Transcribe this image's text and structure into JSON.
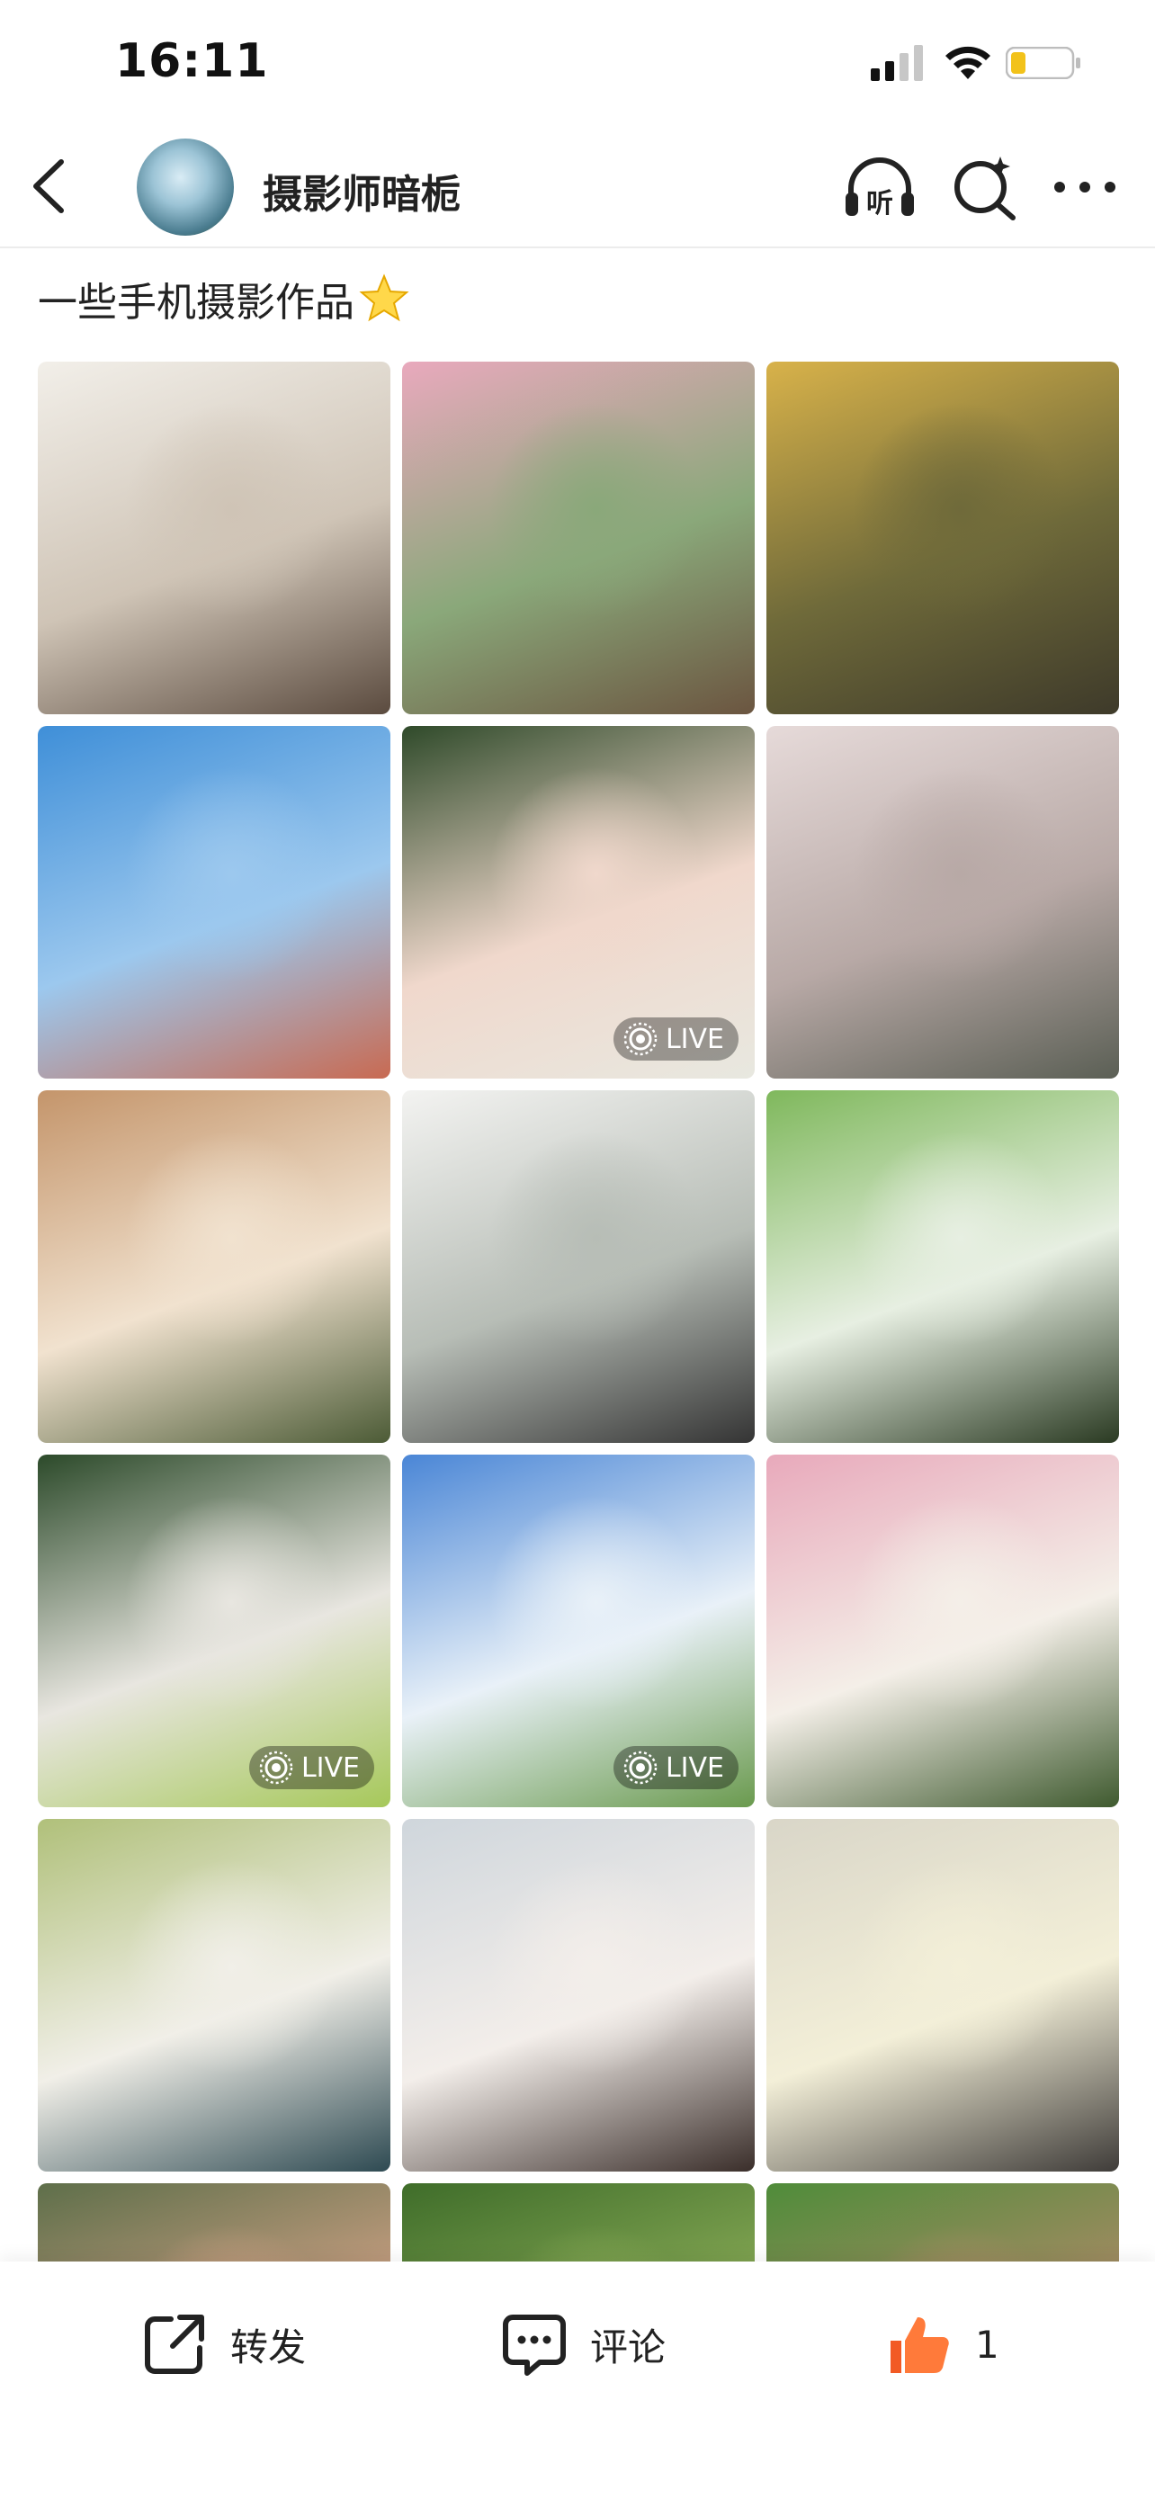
{
  "status_bar": {
    "time": "16:11",
    "icons": [
      "signal-icon",
      "wifi-icon",
      "battery-icon"
    ]
  },
  "nav": {
    "back_icon": "back-chevron-icon",
    "title": "摄影师暗栀",
    "listen_icon": "listen-headphones-icon",
    "listen_label": "听",
    "search_icon": "search-sparkle-icon",
    "more_icon": "more-dots-icon"
  },
  "post": {
    "text": "一些手机摄影作品",
    "emoji": "star-emoji"
  },
  "photos": [
    {
      "live": false,
      "colors": [
        "#f2efe9",
        "#cfc4b6",
        "#5b4b3f"
      ]
    },
    {
      "live": false,
      "colors": [
        "#e9a9bd",
        "#8aa87a",
        "#6b5540"
      ]
    },
    {
      "live": false,
      "colors": [
        "#d8b24a",
        "#6f6a3a",
        "#3e3a2a"
      ]
    },
    {
      "live": false,
      "colors": [
        "#3f8fd8",
        "#9cc8ee",
        "#c86a52"
      ]
    },
    {
      "live": true,
      "colors": [
        "#2f4a2a",
        "#f0d8cc",
        "#e8e8e0"
      ]
    },
    {
      "live": false,
      "colors": [
        "#e6dad9",
        "#b8a9a6",
        "#5b5f55"
      ]
    },
    {
      "live": false,
      "colors": [
        "#c4956b",
        "#f1e2cf",
        "#4c5b36"
      ]
    },
    {
      "live": false,
      "colors": [
        "#f3f3f1",
        "#b7bdb6",
        "#343434"
      ]
    },
    {
      "live": false,
      "colors": [
        "#7fb85c",
        "#e7efe2",
        "#2a3a22"
      ]
    },
    {
      "live": true,
      "colors": [
        "#2c4a2a",
        "#e8e6e0",
        "#a6c85a"
      ]
    },
    {
      "live": true,
      "colors": [
        "#4a86d6",
        "#e9f1f8",
        "#6a9a4e"
      ]
    },
    {
      "live": false,
      "colors": [
        "#e8a9bb",
        "#f4efe8",
        "#3f5a2f"
      ]
    },
    {
      "live": false,
      "colors": [
        "#b0c07a",
        "#f1efe8",
        "#2e4a52"
      ]
    },
    {
      "live": false,
      "colors": [
        "#cfd6dc",
        "#f3eeea",
        "#3a2e2a"
      ]
    },
    {
      "live": false,
      "colors": [
        "#d9d6c8",
        "#f3efd8",
        "#3f3c39"
      ]
    },
    {
      "live": false,
      "colors": [
        "#5e6f4a",
        "#d7a589",
        "#a3b07a"
      ]
    },
    {
      "live": false,
      "colors": [
        "#3f6d2a",
        "#8fb05a",
        "#2c3a20"
      ]
    },
    {
      "live": false,
      "colors": [
        "#4f8c3a",
        "#b38a6a",
        "#7db45a"
      ]
    }
  ],
  "live_label": "LIVE",
  "toolbar": {
    "share_label": "转发",
    "comment_label": "评论",
    "like_count": "1"
  }
}
